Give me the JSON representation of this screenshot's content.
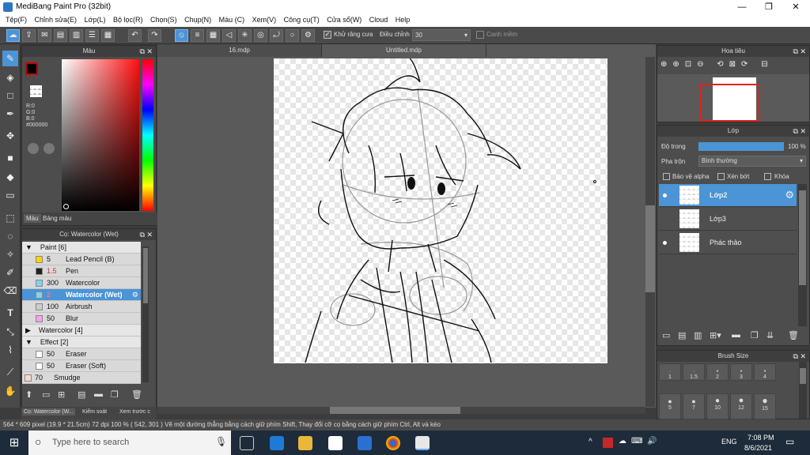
{
  "app": {
    "title": "MediBang Paint Pro (32bit)"
  },
  "menu": [
    "Tệp(F)",
    "Chỉnh sửa(E)",
    "Lớp(L)",
    "Bộ lọc(R)",
    "Chọn(S)",
    "Chụp(N)",
    "Màu (C)",
    "Xem(V)",
    "Công cụ(T)",
    "Cửa sổ(W)",
    "Cloud",
    "Help"
  ],
  "toolbar": {
    "antialias_label": "Khử răng cưa",
    "adjust_label": "Điều chỉnh",
    "adjust_value": "30",
    "snap_label": "Canh mềm"
  },
  "color_panel": {
    "title": "Màu",
    "r": "R:0",
    "g": "G:0",
    "b": "B:0",
    "hex": "#000000",
    "tab_color": "Màu",
    "tab_palette": "Bảng màu"
  },
  "brush_panel": {
    "title": "Cọ: Watercolor (Wet)",
    "groups": [
      {
        "label": "Paint [6]",
        "items": [
          {
            "size": "5",
            "name": "Lead Pencil (B)",
            "color": "#ffd400"
          },
          {
            "size": "1.5",
            "name": "Pen",
            "color": "#222222"
          },
          {
            "size": "300",
            "name": "Watercolor",
            "color": "#7fd3f0"
          },
          {
            "size": "2",
            "name": "Watercolor (Wet)",
            "color": "#7fd3f0"
          },
          {
            "size": "100",
            "name": "Airbrush",
            "color": "#cccccc"
          },
          {
            "size": "50",
            "name": "Blur",
            "color": "#ff9ff0"
          }
        ]
      },
      {
        "label": "Watercolor [4]"
      },
      {
        "label": "Effect [2]",
        "items": [
          {
            "size": "50",
            "name": "Eraser",
            "color": "#ffffff"
          },
          {
            "size": "50",
            "name": "Eraser (Soft)",
            "color": "#ffffff"
          },
          {
            "size": "70",
            "name": "Smudge",
            "color": "#f5d9c8"
          }
        ]
      }
    ],
    "bottom_tabs": [
      "Cọ: Watercolor (W...",
      "Kiểm soát",
      "Xem trước c"
    ]
  },
  "doc_tabs": [
    "16.mdp",
    "Untitled.mdp"
  ],
  "navigator": {
    "title": "Hoa tiêu"
  },
  "layer_panel": {
    "title": "Lớp",
    "opacity_label": "Độ trong",
    "opacity_value": "100 %",
    "opacity_fraction": 1.0,
    "blend_label": "Pha trộn",
    "blend_value": "Bình thường",
    "protect_alpha": "Bảo vệ alpha",
    "clipping": "Xén bớt",
    "lock": "Khóa",
    "layers": [
      {
        "name": "Lớp2",
        "visible": true,
        "selected": true
      },
      {
        "name": "Lớp3",
        "visible": false,
        "selected": false
      },
      {
        "name": "Phác thảo",
        "visible": true,
        "selected": false
      }
    ]
  },
  "brush_size": {
    "title": "Brush Size",
    "sizes": [
      "1",
      "1.5",
      "2",
      "3",
      "4",
      "5",
      "7",
      "10",
      "12",
      "15"
    ]
  },
  "status": {
    "text": "564 * 609 pixel   (19.9 * 21.5cm)   72 dpi   100 %   ( 542, 301 )  Vẽ một đường thẳng bằng cách giữ phím Shift, Thay đổi cỡ cọ bằng cách giữ phím Ctrl, Alt và kéo"
  },
  "taskbar": {
    "search_placeholder": "Type here to search",
    "lang": "ENG",
    "time": "7:08 PM",
    "date": "8/6/2021"
  },
  "colors": {
    "accent": "#4b94d6",
    "panel": "#4d4d4d",
    "taskbar": "#1e2b3a"
  }
}
